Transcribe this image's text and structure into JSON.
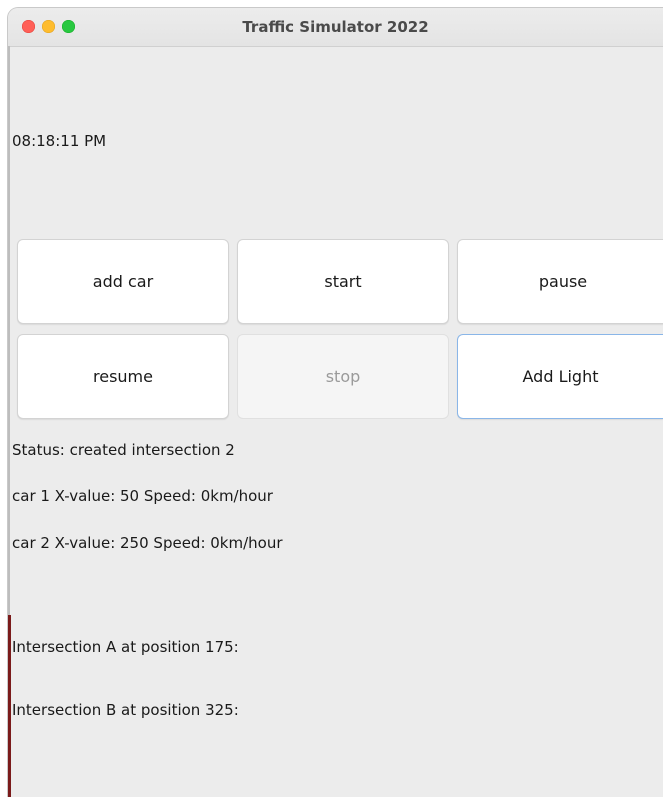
{
  "window": {
    "title": "Traffic Simulator 2022"
  },
  "clock": {
    "time": "08:18:11 PM"
  },
  "buttons": {
    "add_car": "add car",
    "start": "start",
    "pause": "pause",
    "resume": "resume",
    "stop": "stop",
    "add_light": "Add Light"
  },
  "status": {
    "text": "Status: created intersection 2"
  },
  "cars": [
    {
      "text": "car 1 X-value: 50 Speed: 0km/hour"
    },
    {
      "text": "car 2 X-value: 250 Speed: 0km/hour"
    }
  ],
  "intersections": [
    {
      "text": "Intersection A at position 175:"
    },
    {
      "text": "Intersection B at position 325:"
    }
  ],
  "colors": {
    "close": "#ff5f57",
    "minimize": "#febc2e",
    "maximize": "#28c840",
    "focus_ring": "#8ab6e8"
  },
  "icons": {
    "close": "close-icon",
    "minimize": "minimize-icon",
    "maximize": "maximize-icon"
  }
}
